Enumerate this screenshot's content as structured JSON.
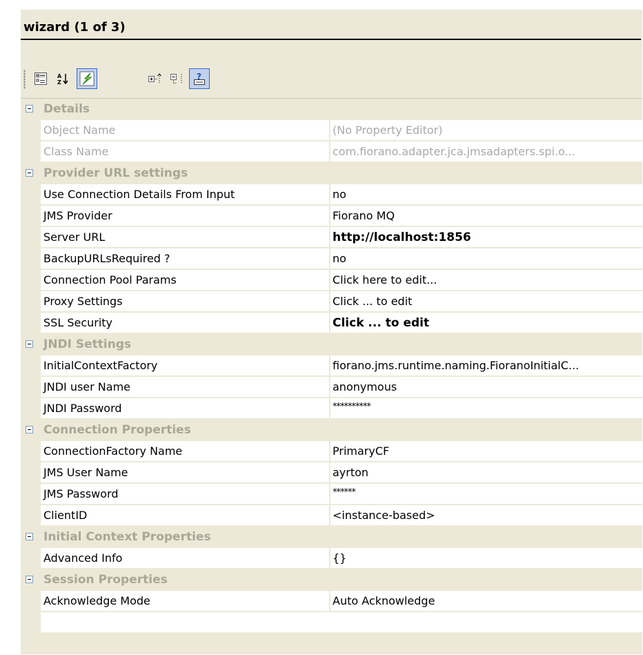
{
  "title": "wizard (1 of 3)",
  "toolbar": {
    "buttons": [
      {
        "icon": "categorized-icon",
        "active": true
      },
      {
        "icon": "alphabetical-sort-icon",
        "active": false
      },
      {
        "icon": "lightning-icon",
        "active": true
      },
      {
        "icon": "expand-all-icon",
        "active": false
      },
      {
        "icon": "collapse-all-icon",
        "active": false
      },
      {
        "icon": "help-icon",
        "active": true
      }
    ]
  },
  "sections": [
    {
      "label": "Details",
      "rows": [
        {
          "key": "Object Name",
          "value": "(No Property Editor)",
          "readonly": true
        },
        {
          "key": "Class Name",
          "value": "com.fiorano.adapter.jca.jmsadapters.spi.o...",
          "readonly": true
        }
      ]
    },
    {
      "label": "Provider URL settings",
      "rows": [
        {
          "key": "Use Connection Details From Input",
          "value": "no"
        },
        {
          "key": "JMS Provider",
          "value": "Fiorano MQ"
        },
        {
          "key": "Server URL",
          "value": "http://localhost:1856",
          "bold": true
        },
        {
          "key": "BackupURLsRequired ?",
          "value": "no"
        },
        {
          "key": "Connection Pool Params",
          "value": "Click here to edit..."
        },
        {
          "key": "Proxy Settings",
          "value": "Click ... to edit"
        },
        {
          "key": "SSL Security",
          "value": "Click ... to edit",
          "bold": true
        }
      ]
    },
    {
      "label": "JNDI Settings",
      "rows": [
        {
          "key": "InitialContextFactory",
          "value": "fiorano.jms.runtime.naming.FioranoInitialC..."
        },
        {
          "key": "JNDI user Name",
          "value": "anonymous"
        },
        {
          "key": "JNDI Password",
          "value": "**********",
          "password": true
        }
      ]
    },
    {
      "label": "Connection Properties",
      "rows": [
        {
          "key": "ConnectionFactory Name",
          "value": "PrimaryCF"
        },
        {
          "key": "JMS User Name",
          "value": "ayrton"
        },
        {
          "key": "JMS Password",
          "value": "******",
          "password": true
        },
        {
          "key": "ClientID",
          "value": "<instance-based>"
        }
      ]
    },
    {
      "label": "Initial Context Properties",
      "rows": [
        {
          "key": "Advanced Info",
          "value": "{}"
        }
      ]
    },
    {
      "label": "Session Properties",
      "rows": [
        {
          "key": "Acknowledge Mode",
          "value": "Auto Acknowledge"
        }
      ]
    }
  ]
}
